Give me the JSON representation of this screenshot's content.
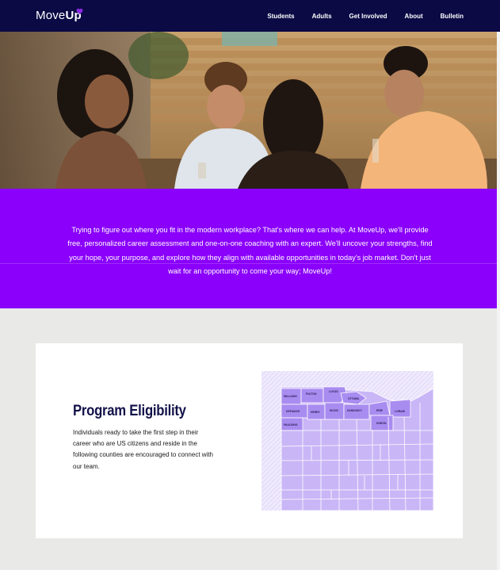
{
  "nav": {
    "logo_part1": "Move",
    "logo_part2": "Up",
    "links": [
      "Students",
      "Adults",
      "Get Involved",
      "About",
      "Bulletin"
    ]
  },
  "band": {
    "text": "Trying to figure out where you fit in the modern workplace? That's where we can help. At MoveUp, we'll provide free, personalized career assessment and one-on-one coaching with an expert. We'll uncover your strengths, find your hope, your purpose, and explore how they align with available opportunities in today's job market. Don't just wait for an opportunity to come your way; MoveUp!"
  },
  "eligibility": {
    "title": "Program Eligibility",
    "body": "Individuals ready to take the first step in their career who are US citizens and reside in the following counties are encouraged to connect with our team.",
    "counties": [
      "WILLIAMS",
      "FULTON",
      "LUCAS",
      "OTTAWA",
      "DEFIANCE",
      "HENRY",
      "WOOD",
      "SANDUSKY",
      "ERIE",
      "LORAIN",
      "HURON",
      "PAULDING"
    ]
  },
  "colors": {
    "nav_bg": "#0b0a45",
    "accent_purple": "#8a00fb",
    "heading_navy": "#12124a",
    "map_fill": "#c9b6f7",
    "map_highlight": "#a98cf0"
  },
  "icons": [
    "heart-icon"
  ]
}
